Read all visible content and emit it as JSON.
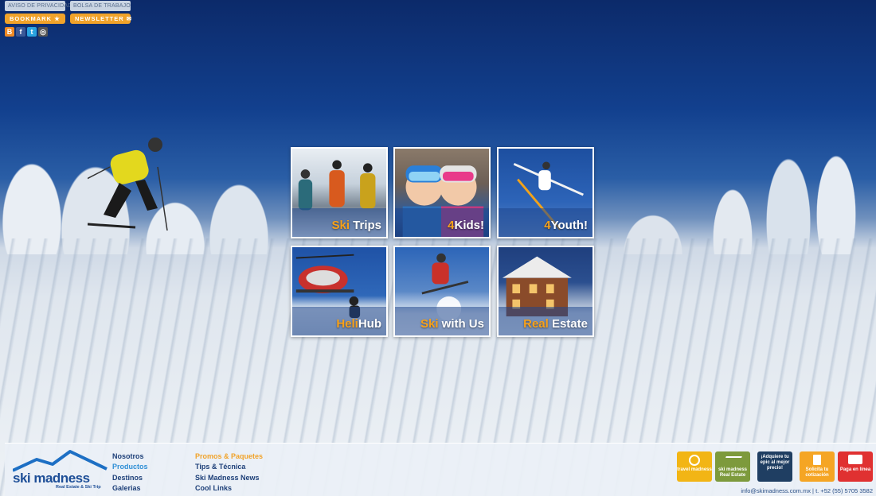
{
  "top": {
    "privacy": "AVISO DE PRIVACIDAD",
    "jobs": "BOLSA DE TRABAJO",
    "bookmark": "BOOKMARK ★",
    "newsletter": "NEWSLETTER ✉",
    "social": [
      "blogger-icon",
      "facebook-icon",
      "twitter-icon",
      "instagram-icon"
    ]
  },
  "tiles": [
    {
      "hl": "Ski",
      "rest": " Trips"
    },
    {
      "hl": "4",
      "rest": "Kids!"
    },
    {
      "hl": "4",
      "rest": "Youth!"
    },
    {
      "hl": "Heli",
      "rest": "Hub"
    },
    {
      "hl": "Ski",
      "rest": " with Us"
    },
    {
      "hl": "Real",
      "rest": " Estate"
    }
  ],
  "footer": {
    "logo_name": "ski madness",
    "logo_tag": "Real Estate & Ski Trip",
    "nav1": [
      "Nosotros",
      "Productos",
      "Destinos",
      "Galerias"
    ],
    "nav2": [
      "Promos & Paquetes",
      "Tips & Técnica",
      "Ski Madness News",
      "Cool Links"
    ],
    "badges": {
      "travel": "travel madness",
      "sm_real": "ski madness Real Estate",
      "epic": "¡Adquiere tu epic al mejor precio!",
      "quote": "Solicita tu cotización",
      "pay": "Paga en línea"
    },
    "contact": "info@skimadness.com.mx | t. +52 (55) 5705 3582"
  },
  "colors": {
    "accent": "#f1a32a",
    "brand": "#1d4e97",
    "sky": "#12408e"
  }
}
